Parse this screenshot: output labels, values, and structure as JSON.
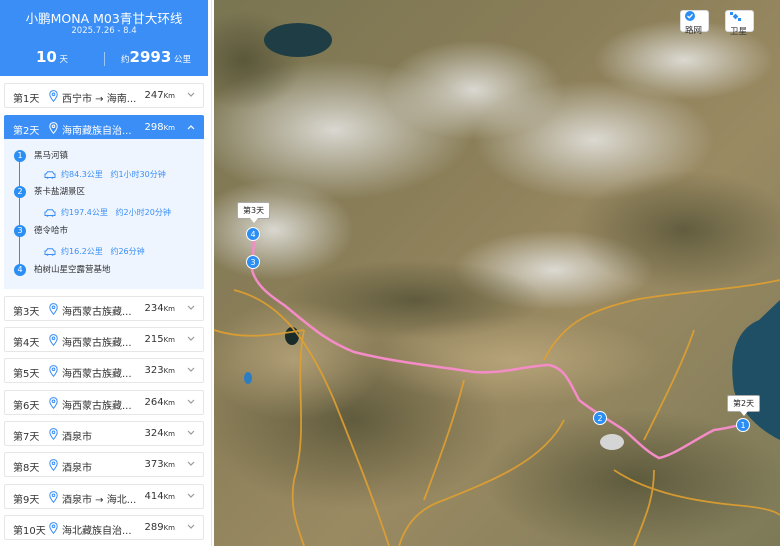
{
  "header": {
    "title": "小鹏MONA M03青甘大环线",
    "date_range": "2025.7.26 - 8.4",
    "days_value": "10",
    "days_unit": "天",
    "distance_prefix": "约",
    "distance_value": "2993",
    "distance_unit": "公里"
  },
  "days": [
    {
      "label": "第1天",
      "route": "西宁市 → 海南...",
      "km": "247",
      "unit": "Km"
    },
    {
      "label": "第2天",
      "route": "海南藏族自治...",
      "km": "298",
      "unit": "Km"
    },
    {
      "label": "第3天",
      "route": "海西蒙古族藏...",
      "km": "234",
      "unit": "Km"
    },
    {
      "label": "第4天",
      "route": "海西蒙古族藏...",
      "km": "215",
      "unit": "Km"
    },
    {
      "label": "第5天",
      "route": "海西蒙古族藏...",
      "km": "323",
      "unit": "Km"
    },
    {
      "label": "第6天",
      "route": "海西蒙古族藏...",
      "km": "264",
      "unit": "Km"
    },
    {
      "label": "第7天",
      "route": "酒泉市",
      "km": "324",
      "unit": "Km"
    },
    {
      "label": "第8天",
      "route": "酒泉市",
      "km": "373",
      "unit": "Km"
    },
    {
      "label": "第9天",
      "route": "酒泉市 → 海北...",
      "km": "414",
      "unit": "Km"
    },
    {
      "label": "第10天",
      "route": "海北藏族自治...",
      "km": "289",
      "unit": "Km"
    }
  ],
  "active_day_stops": [
    {
      "num": "1",
      "name": "黑马河镇"
    },
    {
      "num": "2",
      "name": "茶卡盐湖景区"
    },
    {
      "num": "3",
      "name": "德令哈市"
    },
    {
      "num": "4",
      "name": "柏树山星空露营基地"
    }
  ],
  "active_day_legs": [
    {
      "distance": "约84.3公里",
      "duration": "约1小时30分钟"
    },
    {
      "distance": "约197.4公里",
      "duration": "约2小时20分钟"
    },
    {
      "distance": "约16.2公里",
      "duration": "约26分钟"
    }
  ],
  "map": {
    "road_button": "路网",
    "satellite_button": "卫星",
    "flag_day3": "第3天",
    "flag_day2": "第2天",
    "markers": [
      "1",
      "2",
      "3",
      "4"
    ],
    "route_color": "#f48cc8",
    "road_color": "#e0a030"
  },
  "colors": {
    "accent": "#3a8ef6",
    "marker": "#2b8ef5"
  },
  "icons": {
    "location": "location-pin-icon",
    "chevron": "chevron-down-icon",
    "car": "car-icon",
    "check": "check-icon",
    "satellite": "satellite-icon"
  }
}
